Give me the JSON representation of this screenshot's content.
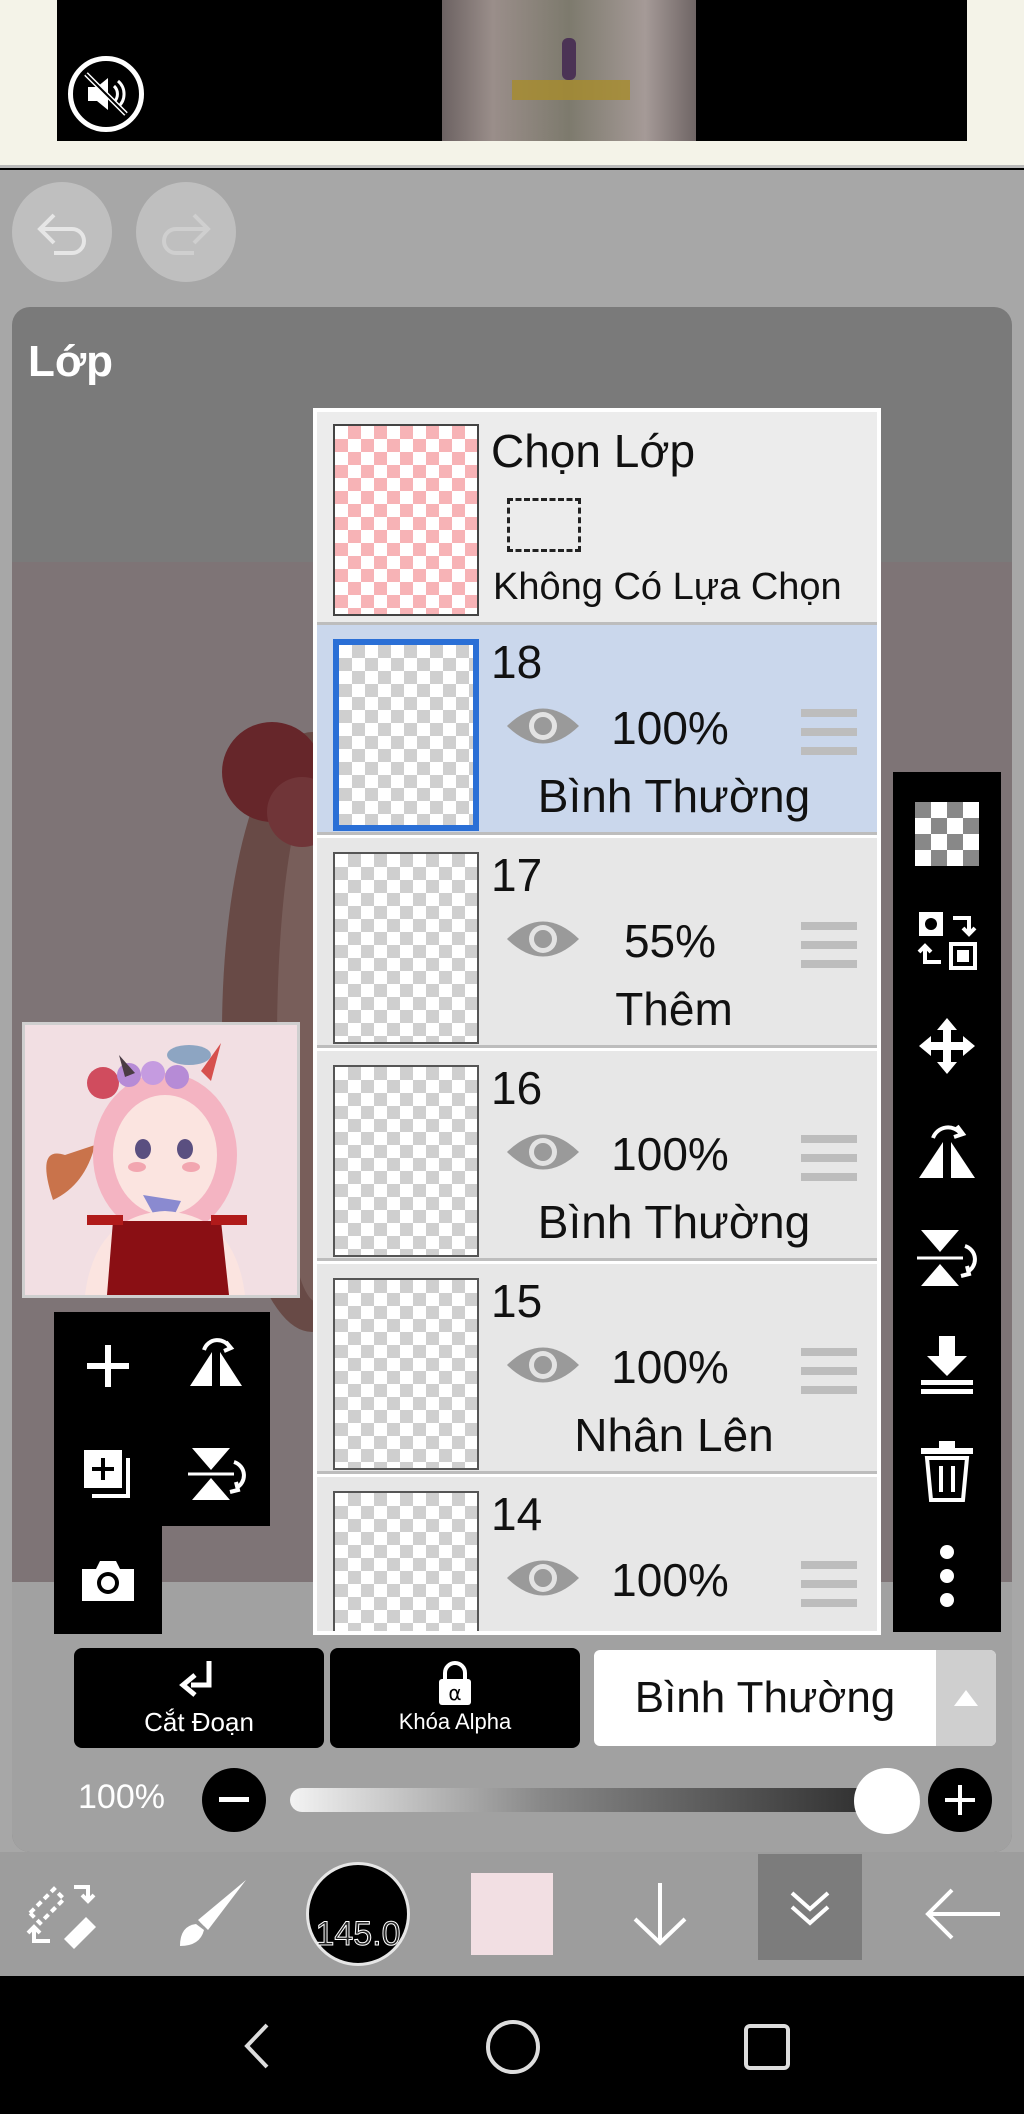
{
  "panel": {
    "title": "Lớp"
  },
  "selection_layer": {
    "title": "Chọn Lớp",
    "status": "Không Có Lựa Chọn"
  },
  "layers": [
    {
      "number": "18",
      "opacity": "100%",
      "blend": "Bình Thường",
      "selected": true
    },
    {
      "number": "17",
      "opacity": "55%",
      "blend": "Thêm",
      "selected": false
    },
    {
      "number": "16",
      "opacity": "100%",
      "blend": "Bình Thường",
      "selected": false
    },
    {
      "number": "15",
      "opacity": "100%",
      "blend": "Nhân Lên",
      "selected": false
    },
    {
      "number": "14",
      "opacity": "100%",
      "blend": "",
      "selected": false
    }
  ],
  "controls": {
    "clipping_label": "Cắt Đoạn",
    "alpha_lock_label": "Khóa Alpha",
    "blend_mode": "Bình Thường",
    "opacity_label": "100%",
    "opacity_value": 1.0
  },
  "toolbar": {
    "brush_size": "145.0",
    "color": "#f2dfe3"
  },
  "icons": {
    "ad": [
      "mute-icon"
    ],
    "top": [
      "undo-icon",
      "redo-icon"
    ],
    "right": [
      "transparent-checker-icon",
      "transform-selection-icon",
      "move-icon",
      "flip-horizontal-icon",
      "flip-vertical-icon",
      "merge-down-icon",
      "delete-icon",
      "more-icon"
    ],
    "left": [
      "add-layer-icon",
      "flip-h-icon",
      "add-copy-icon",
      "flip-v-icon",
      "camera-icon"
    ],
    "bottom": [
      "swap-tools-icon",
      "brush-icon",
      "brush-size-icon",
      "color-swatch-icon",
      "down-arrow-icon",
      "layers-collapse-icon",
      "back-arrow-icon"
    ],
    "nav": [
      "back-nav-icon",
      "home-nav-icon",
      "recents-nav-icon"
    ]
  }
}
